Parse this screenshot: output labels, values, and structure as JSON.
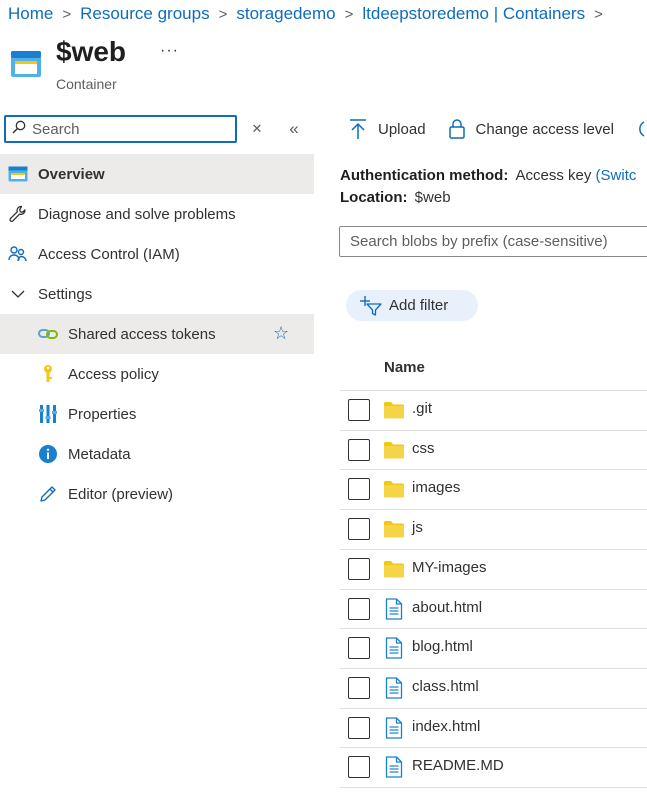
{
  "breadcrumb": {
    "items": [
      "Home",
      "Resource groups",
      "storagedemo",
      "ltdeepstoredemo | Containers"
    ],
    "separator": ">"
  },
  "header": {
    "title": "$web",
    "subtitle": "Container",
    "more_label": "···"
  },
  "sidebar": {
    "search_placeholder": "Search",
    "clear_icon": "✕",
    "collapse_icon": "«",
    "items": [
      {
        "label": "Overview",
        "icon": "container-icon",
        "selected": true
      },
      {
        "label": "Diagnose and solve problems",
        "icon": "wrench-icon"
      },
      {
        "label": "Access Control (IAM)",
        "icon": "people-icon"
      },
      {
        "label": "Settings",
        "icon": "chevron-down-icon"
      },
      {
        "label": "Shared access tokens",
        "icon": "link-icon",
        "favorite_icon": "☆"
      },
      {
        "label": "Access policy",
        "icon": "key-icon"
      },
      {
        "label": "Properties",
        "icon": "properties-icon"
      },
      {
        "label": "Metadata",
        "icon": "info-icon"
      },
      {
        "label": "Editor (preview)",
        "icon": "pencil-icon"
      }
    ]
  },
  "toolbar": {
    "upload_label": "Upload",
    "change_access_label": "Change access level"
  },
  "details": {
    "auth_label": "Authentication method:",
    "auth_value": "Access key",
    "auth_link": "(Switc",
    "location_label": "Location:",
    "location_value": "$web"
  },
  "blob_search": {
    "placeholder": "Search blobs by prefix (case-sensitive)"
  },
  "filter": {
    "add_filter_label": "Add filter"
  },
  "table": {
    "columns": [
      "Name"
    ],
    "rows": [
      {
        "name": ".git",
        "type": "folder"
      },
      {
        "name": "css",
        "type": "folder"
      },
      {
        "name": "images",
        "type": "folder"
      },
      {
        "name": "js",
        "type": "folder"
      },
      {
        "name": "MY-images",
        "type": "folder"
      },
      {
        "name": "about.html",
        "type": "file"
      },
      {
        "name": "blog.html",
        "type": "file"
      },
      {
        "name": "class.html",
        "type": "file"
      },
      {
        "name": "index.html",
        "type": "file"
      },
      {
        "name": "README.MD",
        "type": "file"
      }
    ]
  },
  "colors": {
    "accent": "#0f6cbd",
    "folder": "#f2c811",
    "selected_bg": "#edebe9",
    "filter_bg": "#e8f1fb"
  }
}
